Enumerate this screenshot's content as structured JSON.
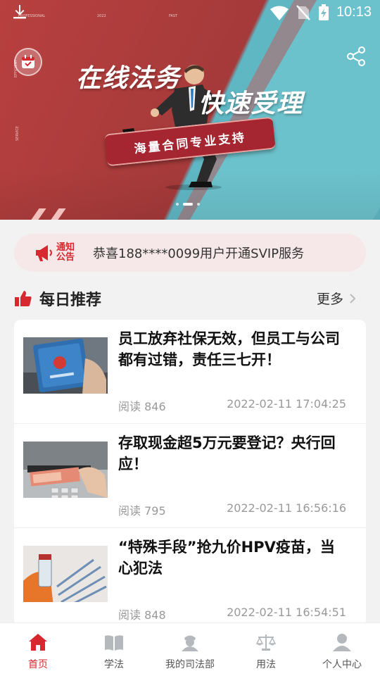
{
  "status_bar": {
    "time": "10:13"
  },
  "banner": {
    "headline_1": "在线法务",
    "headline_2": "快速受理",
    "ribbon": "海量合同专业支持",
    "tiny_texts": [
      "PROFESSIONAL",
      "2022",
      "FAST",
      "EFFICIENT",
      "SERVICE"
    ]
  },
  "notice": {
    "tag_line1": "通知",
    "tag_line2": "公告",
    "text": "恭喜188****0099用户开通SVIP服务"
  },
  "section": {
    "title": "每日推荐",
    "more": "更多"
  },
  "articles": [
    {
      "title": "员工放弃社保无效，但员工与公司都有过错，责任三七开！",
      "reads": "阅读 846",
      "date": "2022-02-11 17:04:25"
    },
    {
      "title": "存取现金超5万元要登记？央行回应！",
      "reads": "阅读 795",
      "date": "2022-02-11 16:56:16"
    },
    {
      "title": "“特殊手段”抢九价HPV疫苗，当心犯法",
      "reads": "阅读 848",
      "date": "2022-02-11 16:54:51"
    }
  ],
  "tabbar": [
    {
      "label": "首页",
      "active": true
    },
    {
      "label": "学法",
      "active": false
    },
    {
      "label": "我的司法部",
      "active": false
    },
    {
      "label": "用法",
      "active": false
    },
    {
      "label": "个人中心",
      "active": false
    }
  ],
  "colors": {
    "accent": "#d7282f",
    "banner_red": "#a53a3a",
    "banner_teal": "#5fb7c4"
  }
}
